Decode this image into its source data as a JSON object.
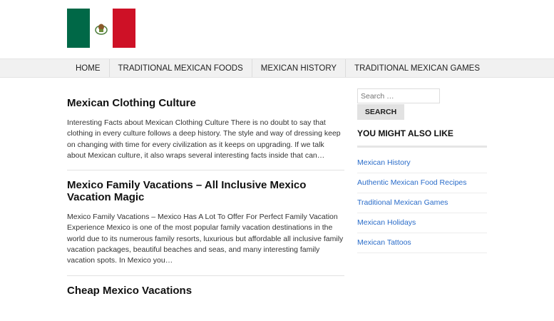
{
  "site": {
    "logo_icon": "mexico-flag-logo"
  },
  "nav": {
    "items": [
      {
        "label": "HOME"
      },
      {
        "label": "TRADITIONAL MEXICAN FOODS"
      },
      {
        "label": "MEXICAN HISTORY"
      },
      {
        "label": "TRADITIONAL MEXICAN GAMES"
      }
    ]
  },
  "posts": [
    {
      "title": "Mexican Clothing Culture",
      "excerpt": "Interesting Facts about Mexican Clothing Culture There is no doubt to say that clothing in every culture follows a deep history. The style and way of dressing keep on changing with time for every civilization as it keeps on upgrading. If we talk about Mexican culture, it also wraps several interesting facts inside that can…"
    },
    {
      "title": "Mexico Family Vacations – All Inclusive Mexico Vacation Magic",
      "excerpt": "Mexico Family Vacations – Mexico Has A Lot To Offer For Perfect Family Vacation Experience Mexico is one of the most popular family vacation destinations in the world due to its numerous family resorts, luxurious but affordable all inclusive family vacation packages, beautiful beaches and seas, and many interesting family vacation spots. In Mexico you…"
    },
    {
      "title": "Cheap Mexico Vacations",
      "excerpt": ""
    }
  ],
  "sidebar": {
    "search": {
      "placeholder": "Search …",
      "button_label": "SEARCH"
    },
    "widget_title": "YOU MIGHT ALSO LIKE",
    "links": [
      {
        "label": "Mexican History"
      },
      {
        "label": "Authentic Mexican Food Recipes"
      },
      {
        "label": "Traditional Mexican Games"
      },
      {
        "label": "Mexican Holidays"
      },
      {
        "label": "Mexican Tattoos"
      }
    ]
  },
  "colors": {
    "link": "#2a6cc9",
    "flag_green": "#006847",
    "flag_red": "#ce1126"
  }
}
